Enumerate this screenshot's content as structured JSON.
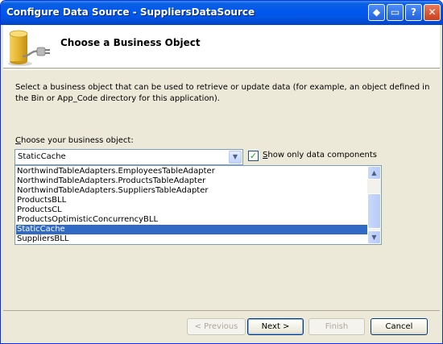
{
  "window": {
    "title": "Configure Data Source - SuppliersDataSource",
    "controls": [
      "◆",
      "▭",
      "?",
      "✕"
    ]
  },
  "header": {
    "title": "Choose a Business Object",
    "icon": "database-plug-icon"
  },
  "description": "Select a business object that can be used to retrieve or update data (for example, an object defined in the Bin or App_Code directory for this application).",
  "business_object": {
    "label_prefix": "C",
    "label_rest": "hoose your business object:",
    "selected_value": "StaticCache",
    "show_only_data_components": {
      "checked": true,
      "label_prefix": "S",
      "label_rest": "how only data components"
    },
    "options": [
      "NorthwindTableAdapters.EmployeesTableAdapter",
      "NorthwindTableAdapters.ProductsTableAdapter",
      "NorthwindTableAdapters.SuppliersTableAdapter",
      "ProductsBLL",
      "ProductsCL",
      "ProductsOptimisticConcurrencyBLL",
      "StaticCache",
      "SuppliersBLL"
    ],
    "selected_index": 6
  },
  "buttons": {
    "previous": "< Previous",
    "next": "Next >",
    "finish": "Finish",
    "cancel": "Cancel"
  },
  "colors": {
    "title_bar": "#0058ee",
    "selection": "#316ac5",
    "dialog_bg": "#ece9d8"
  }
}
